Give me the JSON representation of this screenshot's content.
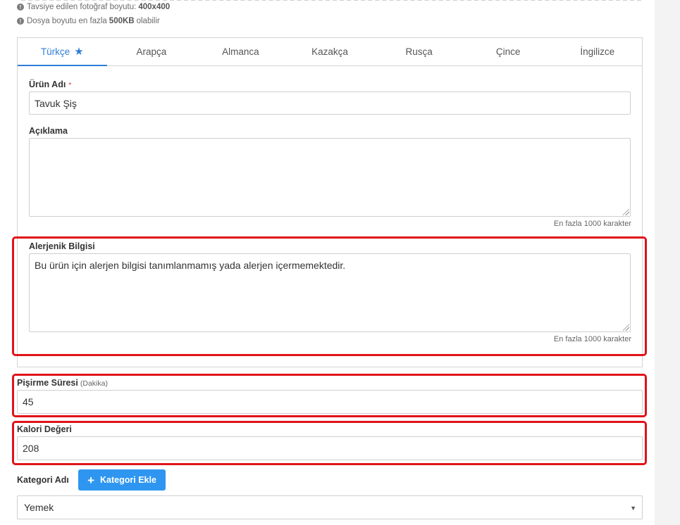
{
  "hints": {
    "photo_size_label": "Tavsiye edilen fotoğraf boyutu:",
    "photo_size_value": "400x400",
    "file_size_label": "Dosya boyutu en fazla",
    "file_size_value": "500KB",
    "file_size_suffix": "olabilir"
  },
  "tabs": [
    {
      "label": "Türkçe",
      "active": true
    },
    {
      "label": "Arapça"
    },
    {
      "label": "Almanca"
    },
    {
      "label": "Kazakça"
    },
    {
      "label": "Rusça"
    },
    {
      "label": "Çince"
    },
    {
      "label": "İngilizce"
    }
  ],
  "form": {
    "product_name_label": "Ürün Adı",
    "required_mark": "*",
    "product_name_value": "Tavuk Şiş",
    "description_label": "Açıklama",
    "description_value": "",
    "description_counter": "En fazla 1000 karakter",
    "allergen_label": "Alerjenik Bilgisi",
    "allergen_value": "Bu ürün için alerjen bilgisi tanımlanmamış yada alerjen içermemektedir.",
    "allergen_counter": "En fazla 1000 karakter",
    "cooking_time_label": "Pişirme Süresi",
    "cooking_time_unit": "(Dakika)",
    "cooking_time_value": "45",
    "calorie_label": "Kalori Değeri",
    "calorie_value": "208",
    "category_label": "Kategori Adı",
    "add_category_button": "Kategori Ekle",
    "category_selected": "Yemek"
  },
  "colors": {
    "accent": "#2f7fd8",
    "button": "#2e96f0",
    "highlight": "#e0131a"
  }
}
